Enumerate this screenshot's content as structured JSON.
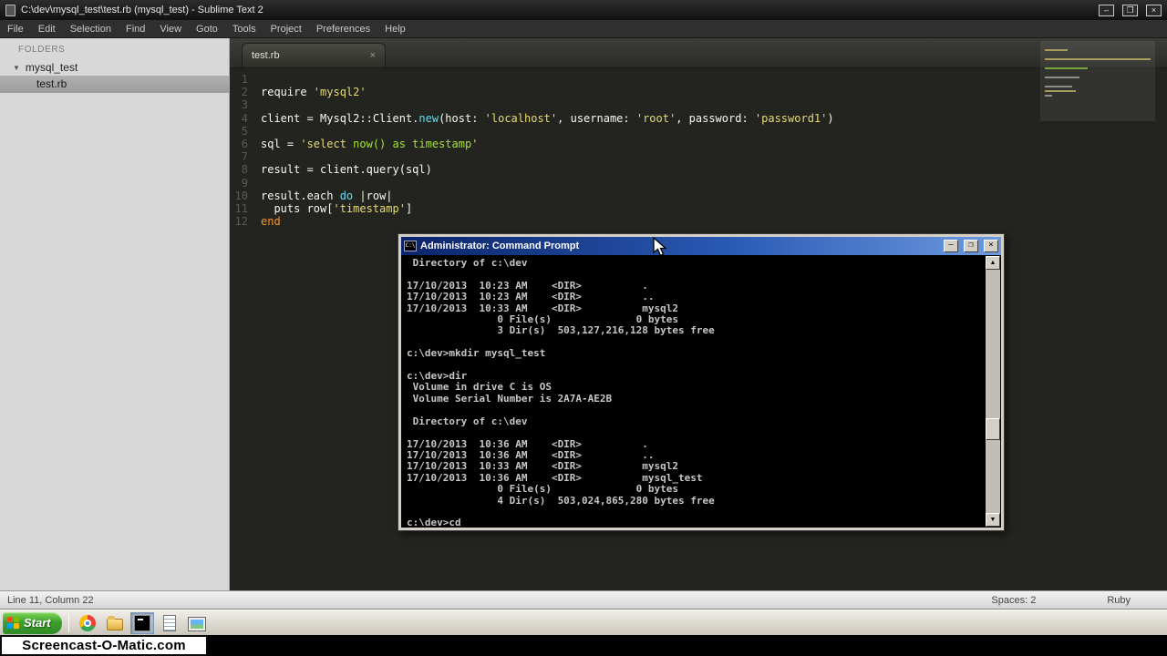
{
  "icons": {
    "minimize": "–",
    "maximize": "❐",
    "close": "×",
    "tab_close": "×",
    "disclosure": "▼",
    "scroll_up": "▲",
    "scroll_down": "▼",
    "cmd_icon_text": "C:\\"
  },
  "sublime": {
    "title": "C:\\dev\\mysql_test\\test.rb (mysql_test) - Sublime Text 2",
    "menus": [
      "File",
      "Edit",
      "Selection",
      "Find",
      "View",
      "Goto",
      "Tools",
      "Project",
      "Preferences",
      "Help"
    ],
    "sidebar": {
      "header": "FOLDERS",
      "folder": "mysql_test",
      "file": "test.rb"
    },
    "tab": "test.rb",
    "status": {
      "position": "Line 11, Column 22",
      "indent": "Spaces: 2",
      "syntax": "Ruby"
    },
    "code": {
      "lines": [
        {
          "n": 1,
          "tokens": []
        },
        {
          "n": 2,
          "tokens": [
            {
              "t": "require ",
              "c": "plain"
            },
            {
              "t": "'mysql2'",
              "c": "string"
            }
          ]
        },
        {
          "n": 3,
          "tokens": []
        },
        {
          "n": 4,
          "tokens": [
            {
              "t": "client = Mysql2::Client.",
              "c": "plain"
            },
            {
              "t": "new",
              "c": "blue"
            },
            {
              "t": "(host: ",
              "c": "plain"
            },
            {
              "t": "'localhost'",
              "c": "string"
            },
            {
              "t": ", username: ",
              "c": "plain"
            },
            {
              "t": "'root'",
              "c": "string"
            },
            {
              "t": ", password: ",
              "c": "plain"
            },
            {
              "t": "'password1'",
              "c": "string"
            },
            {
              "t": ")",
              "c": "plain"
            }
          ]
        },
        {
          "n": 5,
          "tokens": []
        },
        {
          "n": 6,
          "tokens": [
            {
              "t": "sql = ",
              "c": "plain"
            },
            {
              "t": "'select ",
              "c": "string"
            },
            {
              "t": "now()",
              "c": "green"
            },
            {
              "t": " as timestamp",
              "c": "green"
            },
            {
              "t": "'",
              "c": "string"
            }
          ]
        },
        {
          "n": 7,
          "tokens": []
        },
        {
          "n": 8,
          "tokens": [
            {
              "t": "result = client.query(sql)",
              "c": "plain"
            }
          ]
        },
        {
          "n": 9,
          "tokens": []
        },
        {
          "n": 10,
          "tokens": [
            {
              "t": "result.each ",
              "c": "plain"
            },
            {
              "t": "do ",
              "c": "blue"
            },
            {
              "t": "|row|",
              "c": "plain"
            }
          ]
        },
        {
          "n": 11,
          "tokens": [
            {
              "t": "  puts row[",
              "c": "plain"
            },
            {
              "t": "'timestamp'",
              "c": "string"
            },
            {
              "t": "]",
              "c": "plain"
            }
          ]
        },
        {
          "n": 12,
          "tokens": [
            {
              "t": "end",
              "c": "orange"
            }
          ]
        }
      ]
    }
  },
  "cmd": {
    "title": "Administrator: Command Prompt",
    "lines": [
      " Directory of c:\\dev",
      "",
      "17/10/2013  10:23 AM    <DIR>          .",
      "17/10/2013  10:23 AM    <DIR>          ..",
      "17/10/2013  10:33 AM    <DIR>          mysql2",
      "               0 File(s)              0 bytes",
      "               3 Dir(s)  503,127,216,128 bytes free",
      "",
      "c:\\dev>mkdir mysql_test",
      "",
      "c:\\dev>dir",
      " Volume in drive C is OS",
      " Volume Serial Number is 2A7A-AE2B",
      "",
      " Directory of c:\\dev",
      "",
      "17/10/2013  10:36 AM    <DIR>          .",
      "17/10/2013  10:36 AM    <DIR>          ..",
      "17/10/2013  10:33 AM    <DIR>          mysql2",
      "17/10/2013  10:36 AM    <DIR>          mysql_test",
      "               0 File(s)              0 bytes",
      "               4 Dir(s)  503,024,865,280 bytes free",
      "",
      "c:\\dev>cd"
    ]
  },
  "taskbar": {
    "start_label": "Start",
    "quick_launch": [
      {
        "name": "chrome",
        "active": false
      },
      {
        "name": "folder",
        "active": false
      },
      {
        "name": "command-prompt",
        "active": true
      },
      {
        "name": "notepad",
        "active": false
      },
      {
        "name": "image-viewer",
        "active": false
      }
    ]
  },
  "watermark": "Screencast-O-Matic.com"
}
